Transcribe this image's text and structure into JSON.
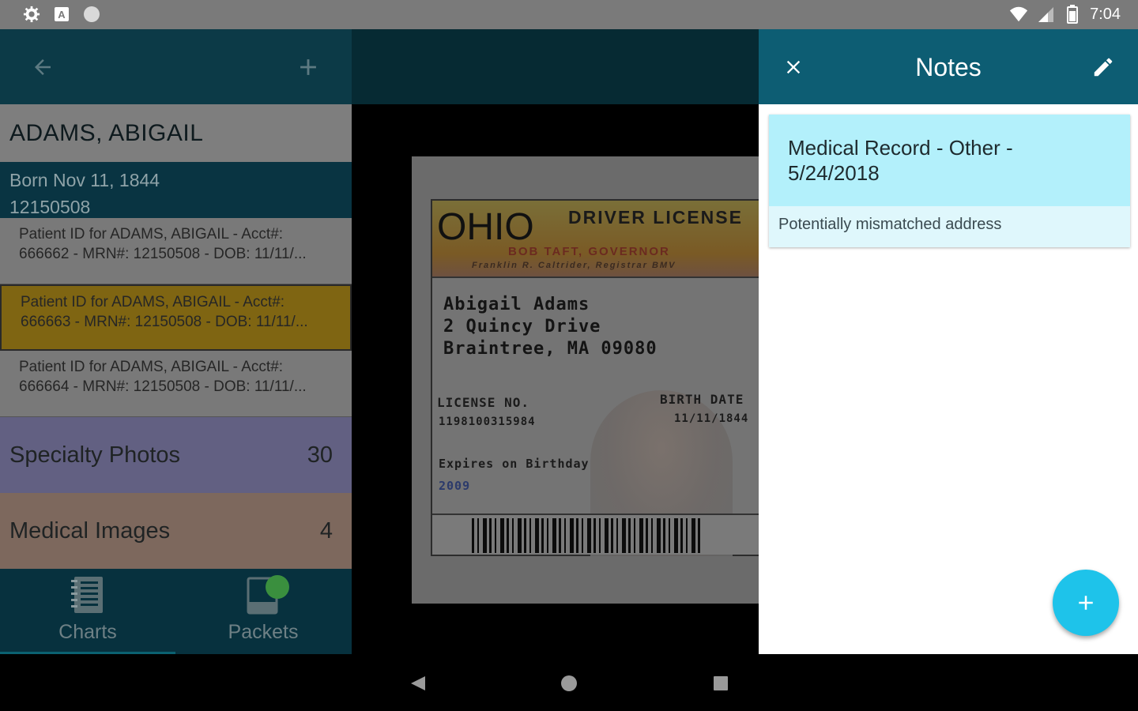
{
  "status_bar": {
    "time": "7:04",
    "left_icons": [
      "settings-icon",
      "a-icon",
      "circle-icon"
    ],
    "right_icons": [
      "wifi-icon",
      "signal-icon",
      "battery-icon"
    ]
  },
  "left_pane": {
    "toolbar": {
      "back_icon": "arrow-left-icon",
      "add_icon": "plus-icon"
    },
    "patient": {
      "name": "ADAMS, ABIGAIL",
      "born": "Born Nov 11, 1844",
      "mrn": "12150508"
    },
    "documents": [
      {
        "line1": "Patient ID for ADAMS, ABIGAIL - Acct#:",
        "line2": "666662 - MRN#: 12150508 - DOB: 11/11/..."
      },
      {
        "line1": "Patient ID for ADAMS, ABIGAIL - Acct#:",
        "line2": "666663 - MRN#: 12150508 - DOB: 11/11/...",
        "selected": true
      },
      {
        "line1": "Patient ID for ADAMS, ABIGAIL - Acct#:",
        "line2": "666664 - MRN#: 12150508 - DOB: 11/11/..."
      }
    ],
    "categories": [
      {
        "label": "Specialty Photos",
        "count": "30",
        "color": "#626082"
      },
      {
        "label": "Medical Images",
        "count": "4",
        "color": "#7d685d"
      }
    ],
    "bottom_nav": {
      "charts_label": "Charts",
      "packets_label": "Packets"
    }
  },
  "license": {
    "state": "OHIO",
    "type": "DRIVER LICENSE",
    "governor": "BOB TAFT, GOVERNOR",
    "registrar": "Franklin R. Caltrider, Registrar BMV",
    "address_line1": "Abigail Adams",
    "address_line2": "2 Quincy Drive",
    "address_line3": "Braintree, MA 09080",
    "license_no_label": "LICENSE NO.",
    "license_no": "1198100315984",
    "birth_date_label": "BIRTH DATE",
    "birth_date": "11/11/1844",
    "expires_label": "Expires on Birthday",
    "expires_year": "2009"
  },
  "notes": {
    "title": "Notes",
    "card": {
      "title_line1": "Medical Record - Other -",
      "title_line2": "5/24/2018",
      "body": "Potentially mismatched address"
    }
  },
  "colors": {
    "notes_toolbar": "#0d5d73",
    "note_header": "#b3f0fb",
    "fab": "#1ec3ea",
    "selected_doc": "#7f6512"
  }
}
